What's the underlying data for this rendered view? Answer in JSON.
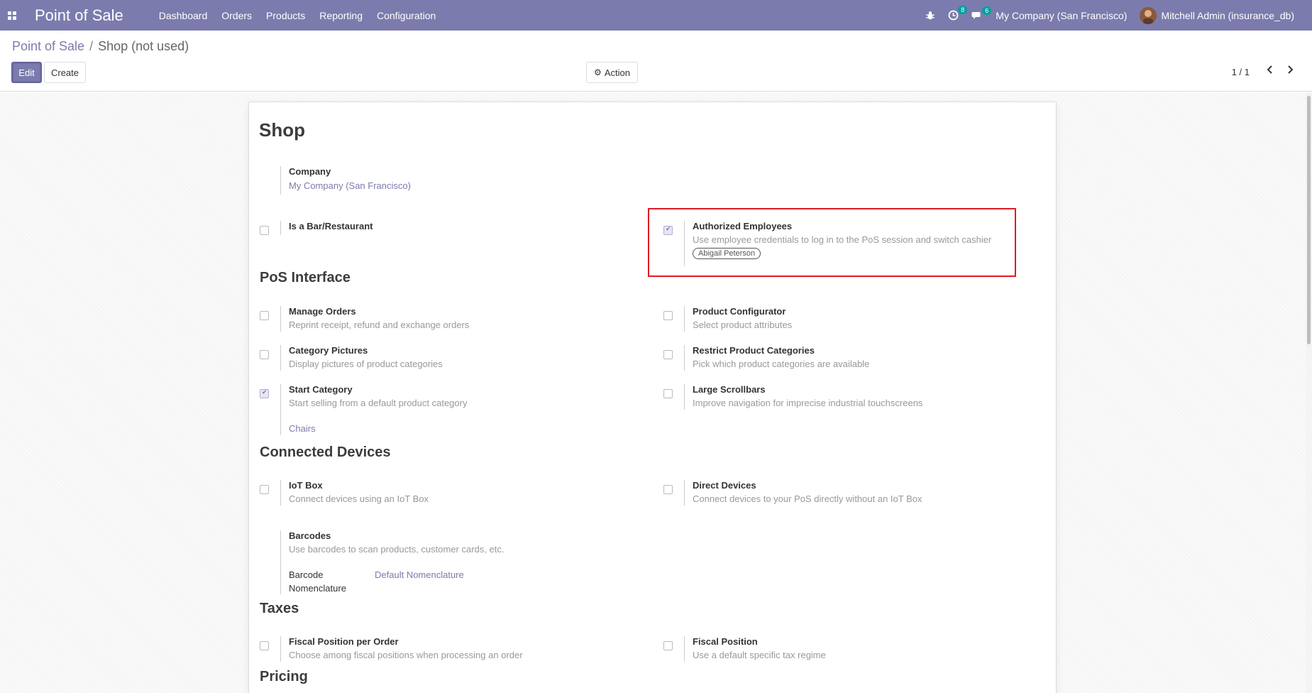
{
  "navbar": {
    "brand": "Point of Sale",
    "menu": [
      "Dashboard",
      "Orders",
      "Products",
      "Reporting",
      "Configuration"
    ],
    "activity_count": "8",
    "messages_count": "6",
    "company": "My Company (San Francisco)",
    "user": "Mitchell Admin (insurance_db)"
  },
  "breadcrumb": {
    "parent": "Point of Sale",
    "separator": "/",
    "current": "Shop (not used)"
  },
  "buttons": {
    "edit": "Edit",
    "create": "Create",
    "action": "Action"
  },
  "pager": "1 / 1",
  "form": {
    "title": "Shop",
    "company": {
      "label": "Company",
      "value": "My Company (San Francisco)"
    },
    "bar_restaurant": {
      "label": "Is a Bar/Restaurant",
      "checked": false
    },
    "authorized_employees": {
      "label": "Authorized Employees",
      "desc": "Use employee credentials to log in to the PoS session and switch cashier",
      "tag": "Abigail Peterson",
      "checked": true
    },
    "sections": {
      "pos_interface": "PoS Interface",
      "connected_devices": "Connected Devices",
      "taxes": "Taxes",
      "pricing": "Pricing"
    },
    "manage_orders": {
      "label": "Manage Orders",
      "desc": "Reprint receipt, refund and exchange orders",
      "checked": false
    },
    "product_configurator": {
      "label": "Product Configurator",
      "desc": "Select product attributes",
      "checked": false
    },
    "category_pictures": {
      "label": "Category Pictures",
      "desc": "Display pictures of product categories",
      "checked": false
    },
    "restrict_categories": {
      "label": "Restrict Product Categories",
      "desc": "Pick which product categories are available",
      "checked": false
    },
    "start_category": {
      "label": "Start Category",
      "desc": "Start selling from a default product category",
      "value": "Chairs",
      "checked": true
    },
    "large_scrollbars": {
      "label": "Large Scrollbars",
      "desc": "Improve navigation for imprecise industrial touchscreens",
      "checked": false
    },
    "iot_box": {
      "label": "IoT Box",
      "desc": "Connect devices using an IoT Box",
      "checked": false
    },
    "direct_devices": {
      "label": "Direct Devices",
      "desc": "Connect devices to your PoS directly without an IoT Box",
      "checked": false
    },
    "barcodes": {
      "label": "Barcodes",
      "desc": "Use barcodes to scan products, customer cards, etc.",
      "field_label_1": "Barcode",
      "field_label_2": "Nomenclature",
      "field_value": "Default Nomenclature"
    },
    "fiscal_position_order": {
      "label": "Fiscal Position per Order",
      "desc": "Choose among fiscal positions when processing an order",
      "checked": false
    },
    "fiscal_position": {
      "label": "Fiscal Position",
      "desc": "Use a default specific tax regime",
      "checked": false
    }
  },
  "colors": {
    "navbar": "#7c7bad",
    "link": "#7c7bad",
    "highlight": "#e01b24",
    "badge": "#00a09d"
  }
}
